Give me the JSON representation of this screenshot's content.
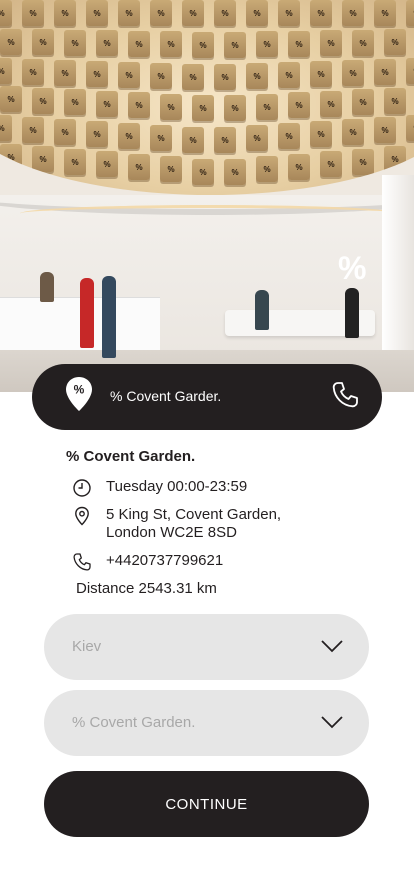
{
  "hero": {
    "wall_logo": "%"
  },
  "store_bar": {
    "pin_icon": "map-pin-percent-icon",
    "pin_glyph": "%",
    "title": "% Covent Garder.",
    "phone_icon": "phone-icon"
  },
  "details": {
    "name": "% Covent Garden.",
    "hours": "Tuesday 00:00-23:59",
    "address_line1": "5 King St, Covent Garden,",
    "address_line2": "London WC2E 8SD",
    "phone": "+4420737799621",
    "distance": "Distance 2543.31 km",
    "icons": {
      "hours": "clock-icon",
      "address": "location-pin-icon",
      "phone": "phone-icon"
    }
  },
  "city_select": {
    "value": "Kiev",
    "icon": "chevron-down-icon"
  },
  "store_select": {
    "value": "% Covent Garden.",
    "icon": "chevron-down-icon"
  },
  "continue_label": "CONTINUE",
  "colors": {
    "dark": "#231f20",
    "select_bg": "#e6e6e6",
    "placeholder": "#a8a8a8"
  }
}
